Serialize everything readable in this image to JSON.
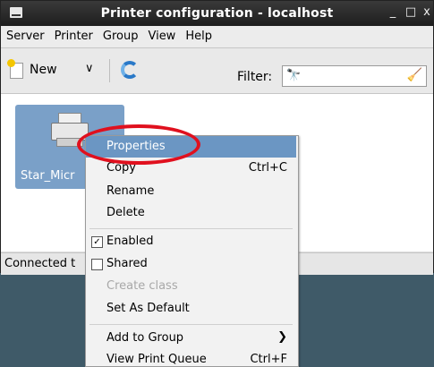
{
  "window": {
    "title": "Printer configuration - localhost",
    "minimize_glyph": "_",
    "maximize_glyph": "□",
    "close_glyph": "x"
  },
  "menubar": [
    "Server",
    "Printer",
    "Group",
    "View",
    "Help"
  ],
  "toolbar": {
    "new_label": "New",
    "new_arrow": "∨",
    "filter_label": "Filter:",
    "filter_value": ""
  },
  "printers": [
    {
      "name": "Star_Micr"
    }
  ],
  "status": {
    "text": "Connected t"
  },
  "context_menu": {
    "items": [
      {
        "label": "Properties",
        "accel": "",
        "selected": true
      },
      {
        "label": "Copy",
        "accel": "Ctrl+C"
      },
      {
        "label": "Rename",
        "accel": ""
      },
      {
        "label": "Delete",
        "accel": ""
      },
      {
        "label": "Enabled",
        "checked": true
      },
      {
        "label": "Shared",
        "checked": false
      },
      {
        "label": "Create class",
        "disabled": true
      },
      {
        "label": "Set As Default",
        "accel": ""
      },
      {
        "label": "Add to Group",
        "submenu_arrow": "❯"
      },
      {
        "label": "View Print Queue",
        "accel": "Ctrl+F"
      }
    ]
  },
  "colors": {
    "selection": "#6b96c3",
    "highlight_oval": "#e0101e",
    "desktop": "#3f5a68"
  }
}
